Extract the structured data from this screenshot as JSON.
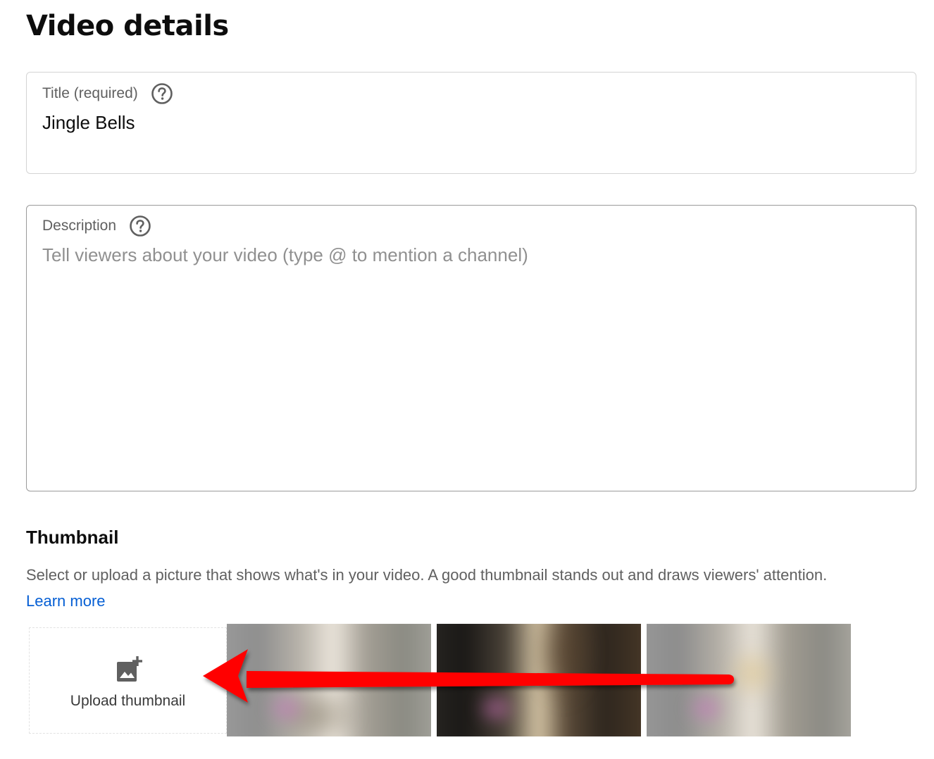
{
  "page": {
    "title": "Video details"
  },
  "title_field": {
    "label": "Title (required)",
    "value": "Jingle Bells",
    "help_icon": "help-circle-icon"
  },
  "description_field": {
    "label": "Description",
    "placeholder": "Tell viewers about your video (type @ to mention a channel)",
    "value": "",
    "help_icon": "help-circle-icon"
  },
  "thumbnail": {
    "heading": "Thumbnail",
    "description": "Select or upload a picture that shows what's in your video. A good thumbnail stands out and draws viewers' attention.",
    "learn_more": "Learn more",
    "upload_label": "Upload thumbnail",
    "upload_icon": "add-photo-icon",
    "suggested_count": 3
  },
  "colors": {
    "link": "#065fd4",
    "arrow_annotation": "#ff0000",
    "label_gray": "#606060",
    "placeholder_gray": "#909090"
  }
}
